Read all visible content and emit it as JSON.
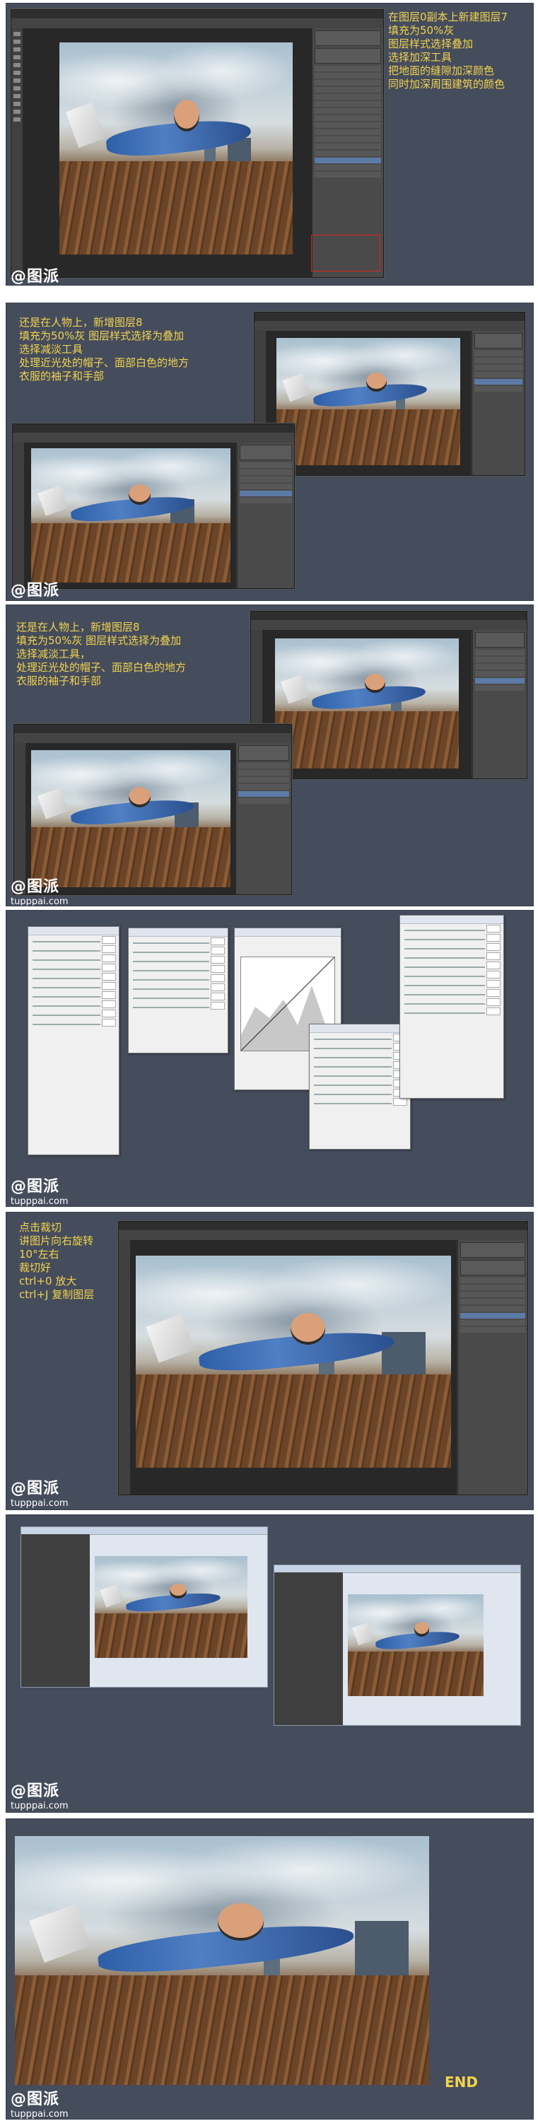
{
  "panels": [
    {
      "note_lines": [
        "在图层0副本上新建图层7",
        "填充为50%灰",
        "图层样式选择叠加",
        "选择加深工具",
        "把地面的缝隙加深颜色",
        "同时加深周围建筑的颜色"
      ]
    },
    {
      "note_lines": [
        "还是在人物上，新增图层8",
        "填充为50%灰 图层样式选择为叠加",
        "选择减淡工具",
        "处理近光处的帽子、面部白色的地方",
        "衣服的袖子和手部"
      ]
    },
    {
      "note_lines": [
        "还是在人物上，新增图层8",
        "填充为50%灰 图层样式选择为叠加",
        "选择减淡工具，",
        "处理近光处的帽子、面部白色的地方",
        "衣服的袖子和手部"
      ]
    },
    {
      "note_lines": []
    },
    {
      "note_lines": [
        "点击裁切",
        "讲图片向右旋转",
        "10°左右",
        "裁切好",
        "ctrl+0 放大",
        "ctrl+J 复制图层"
      ]
    },
    {
      "note_lines": []
    },
    {
      "note_lines": [],
      "end_text": "END"
    }
  ],
  "watermark": {
    "logo": "@图派",
    "site": "tupppai.com"
  },
  "colors": {
    "panel_bg": "#454c5c",
    "note_text": "#f2d34e",
    "highlight": "#e02020"
  }
}
